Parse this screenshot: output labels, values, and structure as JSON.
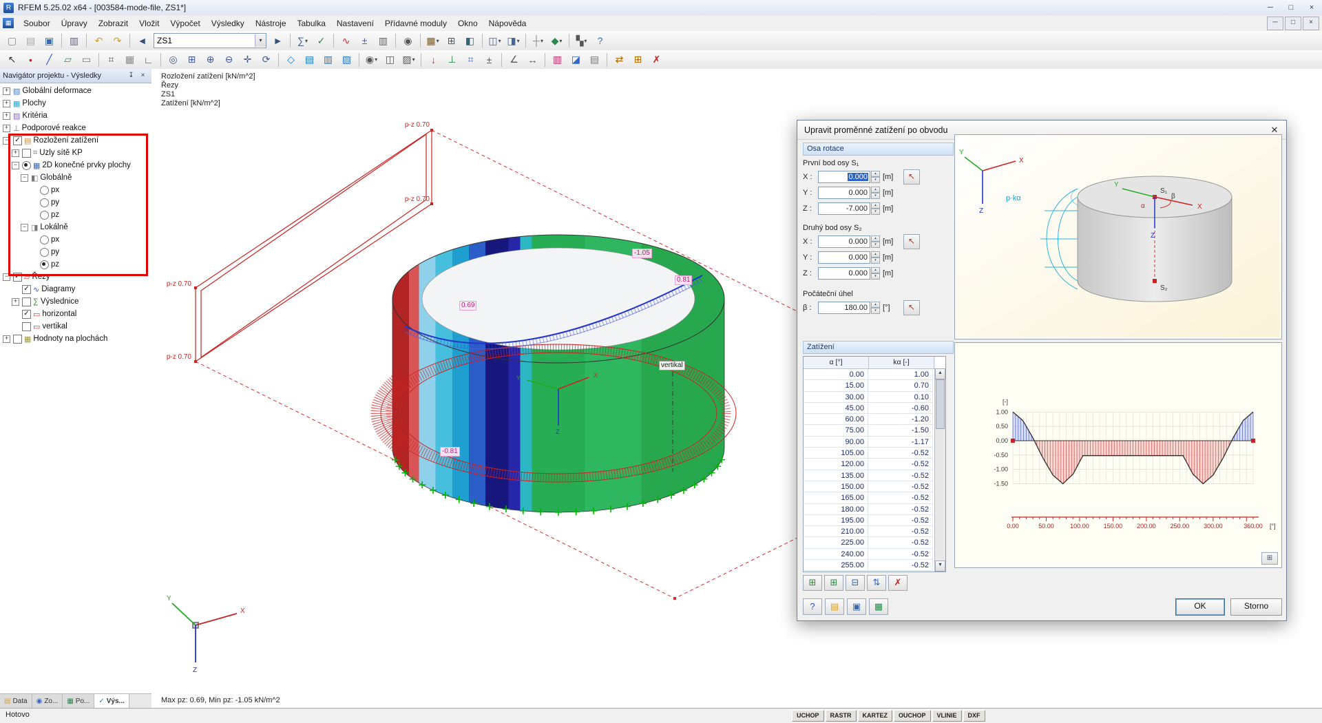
{
  "window": {
    "title": "RFEM 5.25.02 x64 - [003584-mode-file, ZS1*]",
    "app_icon_glyph": "R",
    "controls": {
      "minimize": "─",
      "maximize": "□",
      "close": "×"
    }
  },
  "menu": {
    "items": [
      "Soubor",
      "Úpravy",
      "Zobrazit",
      "Vložit",
      "Výpočet",
      "Výsledky",
      "Nástroje",
      "Tabulka",
      "Nastavení",
      "Přídavné moduly",
      "Okno",
      "Nápověda"
    ],
    "mdi_controls": [
      "─",
      "□",
      "×"
    ]
  },
  "toolbars": {
    "row1": [
      {
        "n": "new-model-button",
        "g": "▢",
        "c": "#8a8a8a"
      },
      {
        "n": "open-model-button",
        "g": "▤",
        "c": "#d9a23a"
      },
      {
        "n": "save-model-button",
        "g": "▣",
        "c": "#3a6ab0"
      },
      {
        "sep": true
      },
      {
        "n": "print-button",
        "g": "▥",
        "c": "#667"
      },
      {
        "sep": true
      },
      {
        "n": "undo-button",
        "g": "↶",
        "c": "#c9a227"
      },
      {
        "n": "redo-button",
        "g": "↷",
        "c": "#c9a227"
      },
      {
        "sep": true
      },
      {
        "n": "previous-load-case-button",
        "g": "◄",
        "c": "#35527a"
      },
      {
        "combo": "ZS1",
        "n": "load-case-combobox"
      },
      {
        "n": "next-load-case-button",
        "g": "►",
        "c": "#35527a"
      },
      {
        "sep": true
      },
      {
        "n": "calculation-button",
        "g": "∑",
        "c": "#445a8c",
        "dd": 1
      },
      {
        "n": "check-model-button",
        "g": "✓",
        "c": "#2a8a4a"
      },
      {
        "sep": true
      },
      {
        "n": "show-results-button",
        "g": "∿",
        "c": "#c23030"
      },
      {
        "n": "result-values-button",
        "g": "±",
        "c": "#3366cc"
      },
      {
        "n": "color-scale-button",
        "g": "▥",
        "c": "#c23060"
      },
      {
        "sep": true
      },
      {
        "n": "camera-snapshot-button",
        "g": "◉",
        "c": "#555"
      },
      {
        "sep": true
      },
      {
        "n": "addon-modules-button",
        "g": "▦",
        "c": "#885500",
        "dd": 1
      },
      {
        "n": "tables-toggle-button",
        "g": "⊞",
        "c": "#336677"
      },
      {
        "n": "navigator-toggle-button",
        "g": "◧",
        "c": "#336677"
      },
      {
        "sep": true
      },
      {
        "n": "new-window-button",
        "g": "◫",
        "c": "#44679a",
        "dd": 1
      },
      {
        "n": "window-layout-button",
        "g": "◨",
        "c": "#44679a",
        "dd": 1
      },
      {
        "sep": true
      },
      {
        "n": "guide-lines-button",
        "g": "┼",
        "c": "#888",
        "dd": 1
      },
      {
        "n": "object-snap-button",
        "g": "◆",
        "c": "#2a8a4a",
        "dd": 1
      },
      {
        "sep": true
      },
      {
        "n": "display-panels-button",
        "g": "▚",
        "c": "#555",
        "dd": 1
      },
      {
        "n": "help-button",
        "g": "?",
        "c": "#2277cc"
      }
    ],
    "row2": [
      {
        "n": "select-objects-button",
        "g": "↖",
        "c": "#333"
      },
      {
        "n": "draw-node-button",
        "g": "•",
        "c": "#bb2222"
      },
      {
        "n": "draw-line-button",
        "g": "╱",
        "c": "#2255cc"
      },
      {
        "n": "draw-surface-button",
        "g": "▱",
        "c": "#2a8a4a"
      },
      {
        "n": "draw-opening-button",
        "g": "▭",
        "c": "#777"
      },
      {
        "sep": true
      },
      {
        "n": "snap-button",
        "g": "⌗",
        "c": "#555"
      },
      {
        "n": "grid-button",
        "g": "▦",
        "c": "#888"
      },
      {
        "n": "ortho-button",
        "g": "∟",
        "c": "#555"
      },
      {
        "sep": true
      },
      {
        "n": "zoom-all-button",
        "g": "◎",
        "c": "#445a8c"
      },
      {
        "n": "zoom-window-button",
        "g": "⊞",
        "c": "#445a8c"
      },
      {
        "n": "zoom-in-button",
        "g": "⊕",
        "c": "#445a8c"
      },
      {
        "n": "zoom-out-button",
        "g": "⊖",
        "c": "#445a8c"
      },
      {
        "n": "pan-view-button",
        "g": "✛",
        "c": "#445a8c"
      },
      {
        "n": "rotate-view-button",
        "g": "⟳",
        "c": "#445a8c"
      },
      {
        "sep": true
      },
      {
        "n": "view-isometric-button",
        "g": "◇",
        "c": "#2277cc"
      },
      {
        "n": "view-xy-button",
        "g": "▤",
        "c": "#2277cc"
      },
      {
        "n": "view-xz-button",
        "g": "▥",
        "c": "#2277cc"
      },
      {
        "n": "view-yz-button",
        "g": "▧",
        "c": "#2277cc"
      },
      {
        "sep": true
      },
      {
        "n": "visibility-button",
        "g": "◉",
        "c": "#555",
        "dd": 1
      },
      {
        "n": "clipping-plane-button",
        "g": "◫",
        "c": "#555"
      },
      {
        "n": "render-mode-button",
        "g": "▨",
        "c": "#555",
        "dd": 1
      },
      {
        "sep": true
      },
      {
        "n": "display-loads-button",
        "g": "↓",
        "c": "#c23030"
      },
      {
        "n": "display-supports-button",
        "g": "⊥",
        "c": "#2a8a4a"
      },
      {
        "n": "display-mesh-button",
        "g": "⌗",
        "c": "#3366cc"
      },
      {
        "n": "display-values-button",
        "g": "±",
        "c": "#555"
      },
      {
        "sep": true
      },
      {
        "n": "measure-angle-button",
        "g": "∠",
        "c": "#555"
      },
      {
        "n": "dimension-button",
        "g": "↔",
        "c": "#555"
      },
      {
        "sep": true
      },
      {
        "n": "panel-colors-button",
        "g": "▥",
        "c": "#c23060"
      },
      {
        "n": "background-color-button",
        "g": "◪",
        "c": "#3366cc"
      },
      {
        "n": "print-graphic-button",
        "g": "▤",
        "c": "#777"
      },
      {
        "sep": true
      },
      {
        "n": "move-copy-button",
        "g": "⇄",
        "c": "#aa6600"
      },
      {
        "n": "mirror-button",
        "g": "⊞",
        "c": "#aa6600"
      },
      {
        "n": "delete-results-button",
        "g": "✗",
        "c": "#c22222"
      }
    ]
  },
  "navigator": {
    "title": "Navigátor projektu - Výsledky",
    "pin_glyph": "↧",
    "close_glyph": "×",
    "tree": [
      {
        "label": "Globální deformace",
        "lv": 0,
        "ex": "+",
        "icon": "deformation",
        "glyph": "▧",
        "color": "#4477cc"
      },
      {
        "label": "Plochy",
        "lv": 0,
        "ex": "+",
        "icon": "surfaces",
        "glyph": "▦",
        "color": "#22aacc"
      },
      {
        "label": "Kritéria",
        "lv": 0,
        "ex": "+",
        "icon": "criteria",
        "glyph": "▨",
        "color": "#8866cc"
      },
      {
        "label": "Podporové reakce",
        "lv": 0,
        "ex": "+",
        "icon": "support-reactions",
        "glyph": "⊥",
        "color": "#cc4444"
      },
      {
        "label": "Rozložení zatížení",
        "lv": 0,
        "ex": "-",
        "chk": "c",
        "icon": "load-distribution",
        "glyph": "▤",
        "color": "#cc8833"
      },
      {
        "label": "Uzly sítě KP",
        "lv": 1,
        "ex": "+",
        "chk": "u",
        "icon": "mesh-nodes",
        "glyph": "⌗",
        "color": "#666"
      },
      {
        "label": "2D konečné prvky plochy",
        "lv": 1,
        "ex": "-",
        "radio": "on",
        "icon": "fe-elements",
        "glyph": "▦",
        "color": "#3366bb"
      },
      {
        "label": "Globálně",
        "lv": 2,
        "ex": "-",
        "icon": "global-axes",
        "glyph": "◧",
        "color": "#777"
      },
      {
        "label": "px",
        "lv": 3,
        "radio": "off"
      },
      {
        "label": "py",
        "lv": 3,
        "radio": "off"
      },
      {
        "label": "pz",
        "lv": 3,
        "radio": "off"
      },
      {
        "label": "Lokálně",
        "lv": 2,
        "ex": "-",
        "icon": "local-axes",
        "glyph": "◨",
        "color": "#777"
      },
      {
        "label": "px",
        "lv": 3,
        "radio": "off"
      },
      {
        "label": "py",
        "lv": 3,
        "radio": "off"
      },
      {
        "label": "pz",
        "lv": 3,
        "radio": "on"
      },
      {
        "label": "Řezy",
        "lv": 0,
        "ex": "-",
        "chk": "c",
        "icon": "sections",
        "glyph": "▱",
        "color": "#cc3333"
      },
      {
        "label": "Diagramy",
        "lv": 1,
        "chk": "c",
        "icon": "diagrams",
        "glyph": "∿",
        "color": "#3355cc"
      },
      {
        "label": "Výslednice",
        "lv": 1,
        "ex": "+",
        "chk": "u",
        "icon": "resultants",
        "glyph": "∑",
        "color": "#338833"
      },
      {
        "label": "horizontal",
        "lv": 1,
        "chk": "c",
        "icon": "section-line",
        "glyph": "▭",
        "color": "#cc3333"
      },
      {
        "label": "vertikal",
        "lv": 1,
        "chk": "u",
        "icon": "section-line",
        "glyph": "▭",
        "color": "#cc3333"
      },
      {
        "label": "Hodnoty na plochách",
        "lv": 0,
        "ex": "+",
        "chk": "u",
        "icon": "surface-values",
        "glyph": "▦",
        "color": "#999933"
      }
    ],
    "tabs": [
      {
        "label": "Data",
        "glyph": "▤",
        "c": "#d9a23a",
        "active": false
      },
      {
        "label": "Zo...",
        "glyph": "◉",
        "c": "#3366cc",
        "active": false
      },
      {
        "label": "Po...",
        "glyph": "▦",
        "c": "#2a8a4a",
        "active": false
      },
      {
        "label": "Výs...",
        "glyph": "✓",
        "c": "#2277cc",
        "active": true
      }
    ]
  },
  "viewport": {
    "info_lines": [
      "Rozložení zatížení [kN/m^2]",
      "Řezy",
      "ZS1",
      "Zatížení [kN/m^2]"
    ],
    "max_line": "Max pz: 0.69, Min pz: -1.05 kN/m^2",
    "wall_labels": [
      "p-z 0.70",
      "p-z 0.70",
      "p-z 0.70",
      "p-z 0.70"
    ],
    "value_labels": [
      "-1.05",
      "0.81",
      "0.69",
      "-0.81"
    ],
    "section_label": "vertikal",
    "axis_labels": {
      "x": "X",
      "y": "Y",
      "z": "Z"
    }
  },
  "dialog": {
    "title": "Upravit proměnné zatížení po obvodu",
    "close_glyph": "✕",
    "osa_rotace": {
      "header": "Osa rotace",
      "groups": [
        {
          "title": "První bod osy S₁",
          "rows": [
            {
              "label": "X :",
              "value": "0.000",
              "unit": "[m]",
              "selected": true,
              "picker": true
            },
            {
              "label": "Y :",
              "value": "0.000",
              "unit": "[m]"
            },
            {
              "label": "Z :",
              "value": "-7.000",
              "unit": "[m]"
            }
          ]
        },
        {
          "title": "Druhý bod osy S₂",
          "rows": [
            {
              "label": "X :",
              "value": "0.000",
              "unit": "[m]",
              "picker": true
            },
            {
              "label": "Y :",
              "value": "0.000",
              "unit": "[m]"
            },
            {
              "label": "Z :",
              "value": "0.000",
              "unit": "[m]"
            }
          ]
        },
        {
          "title": "Počáteční úhel",
          "rows": [
            {
              "label": "β :",
              "value": "180.00",
              "unit": "[°]",
              "picker": true
            }
          ]
        }
      ]
    },
    "zatizeni": {
      "header": "Zatížení",
      "table": {
        "columns": [
          "α [°]",
          "kα [-]"
        ],
        "rows": [
          [
            "0.00",
            "1.00"
          ],
          [
            "15.00",
            "0.70"
          ],
          [
            "30.00",
            "0.10"
          ],
          [
            "45.00",
            "-0.60"
          ],
          [
            "60.00",
            "-1.20"
          ],
          [
            "75.00",
            "-1.50"
          ],
          [
            "90.00",
            "-1.17"
          ],
          [
            "105.00",
            "-0.52"
          ],
          [
            "120.00",
            "-0.52"
          ],
          [
            "135.00",
            "-0.52"
          ],
          [
            "150.00",
            "-0.52"
          ],
          [
            "165.00",
            "-0.52"
          ],
          [
            "180.00",
            "-0.52"
          ],
          [
            "195.00",
            "-0.52"
          ],
          [
            "210.00",
            "-0.52"
          ],
          [
            "225.00",
            "-0.52"
          ],
          [
            "240.00",
            "-0.52"
          ],
          [
            "255.00",
            "-0.52"
          ]
        ]
      },
      "toolbar": [
        {
          "n": "table-add-row-button",
          "g": "⊞",
          "c": "#2a8a2a"
        },
        {
          "n": "table-insert-row-button",
          "g": "⊞",
          "c": "#2a8a4a"
        },
        {
          "n": "table-delete-row-button",
          "g": "⊟",
          "c": "#3366bb"
        },
        {
          "n": "table-move-row-button",
          "g": "⇅",
          "c": "#3366bb"
        },
        {
          "n": "table-clear-button",
          "g": "✗",
          "c": "#cc2222"
        }
      ]
    },
    "preview": {
      "labels": {
        "x": "X",
        "y": "Y",
        "z": "Z",
        "pka": "p·kα",
        "s1": "S₁",
        "s2": "S₂",
        "alpha": "α",
        "beta": "β"
      }
    },
    "chart_data": {
      "type": "area",
      "title": "",
      "xlabel": "[°]",
      "ylabel": "[-]",
      "x": [
        0,
        15,
        30,
        45,
        60,
        75,
        90,
        105,
        120,
        135,
        150,
        165,
        180,
        195,
        210,
        225,
        240,
        255,
        270,
        285,
        300,
        315,
        330,
        345,
        360
      ],
      "y": [
        1.0,
        0.7,
        0.1,
        -0.6,
        -1.2,
        -1.5,
        -1.17,
        -0.52,
        -0.52,
        -0.52,
        -0.52,
        -0.52,
        -0.52,
        -0.52,
        -0.52,
        -0.52,
        -0.52,
        -0.52,
        -1.17,
        -1.5,
        -1.2,
        -0.6,
        0.1,
        0.7,
        1.0
      ],
      "xlim": [
        0,
        360
      ],
      "ylim": [
        -1.5,
        1.0
      ],
      "xticks": [
        0,
        50,
        100,
        150,
        200,
        250,
        300,
        360
      ],
      "yticks": [
        1.0,
        0.5,
        0.0,
        -0.5,
        -1.0,
        -1.5
      ],
      "grid": true,
      "positive_color": "#5a6ed0",
      "negative_color": "#d45858"
    },
    "tool_buttons": [
      {
        "n": "dialog-help-button",
        "g": "?",
        "c": "#2255cc"
      },
      {
        "n": "dialog-open-button",
        "g": "▤",
        "c": "#d9a23a"
      },
      {
        "n": "dialog-save-button",
        "g": "▣",
        "c": "#3a6ab0"
      },
      {
        "n": "dialog-table-button",
        "g": "▦",
        "c": "#2a8a4a"
      }
    ],
    "chart_settings_glyph": "⊞",
    "buttons": {
      "ok": "OK",
      "cancel": "Storno"
    }
  },
  "statusbar": {
    "status": "Hotovo",
    "toggles": [
      "UCHOP",
      "RASTR",
      "KARTEZ",
      "OUCHOP",
      "VLINIE",
      "DXF"
    ]
  }
}
